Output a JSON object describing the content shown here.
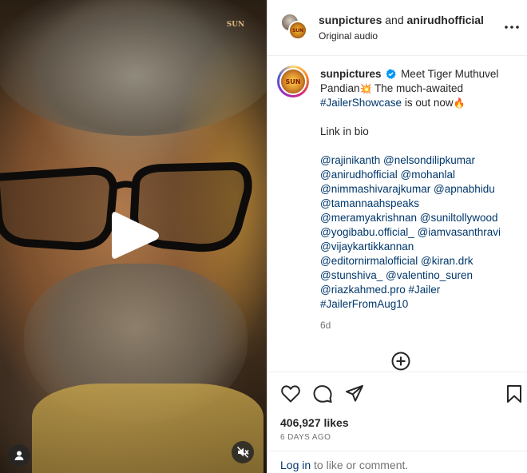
{
  "header": {
    "user1": "sunpictures",
    "joiner": "and",
    "user2": "anirudhofficial",
    "audio": "Original audio"
  },
  "media": {
    "watermark": "SUN"
  },
  "caption": {
    "user": "sunpictures",
    "text1": "Meet Tiger Muthuvel",
    "text2": "Pandian",
    "emoji_explosion": "💥",
    "text3": " The much-awaited",
    "hashtag_showcase": "#JailerShowcase",
    "text4": " is out now",
    "emoji_fire": "🔥",
    "link_in_bio": "Link in bio",
    "mentions": [
      [
        "@rajinikanth",
        "@nelsondilipkumar"
      ],
      [
        "@anirudhofficial",
        "@mohanlal"
      ],
      [
        "@nimmashivarajkumar",
        "@apnabhidu"
      ],
      [
        "@tamannaahspeaks"
      ],
      [
        "@meramyakrishnan",
        "@suniltollywood"
      ],
      [
        "@yogibabu.official_",
        "@iamvasanthravi"
      ],
      [
        "@vijaykartikkannan"
      ],
      [
        "@editornirmalofficial",
        "@kiran.drk"
      ],
      [
        "@stunshiva_",
        "@valentino_suren"
      ],
      [
        "@riazkahmed.pro",
        "#Jailer"
      ],
      [
        "#JailerFromAug10"
      ]
    ],
    "age": "6d"
  },
  "likes": "406,927 likes",
  "date": "6 DAYS AGO",
  "footer": {
    "login": "Log in",
    "rest": " to like or comment."
  },
  "colors": {
    "link": "#00376b",
    "verified": "#0095f6",
    "muted": "#737373"
  }
}
